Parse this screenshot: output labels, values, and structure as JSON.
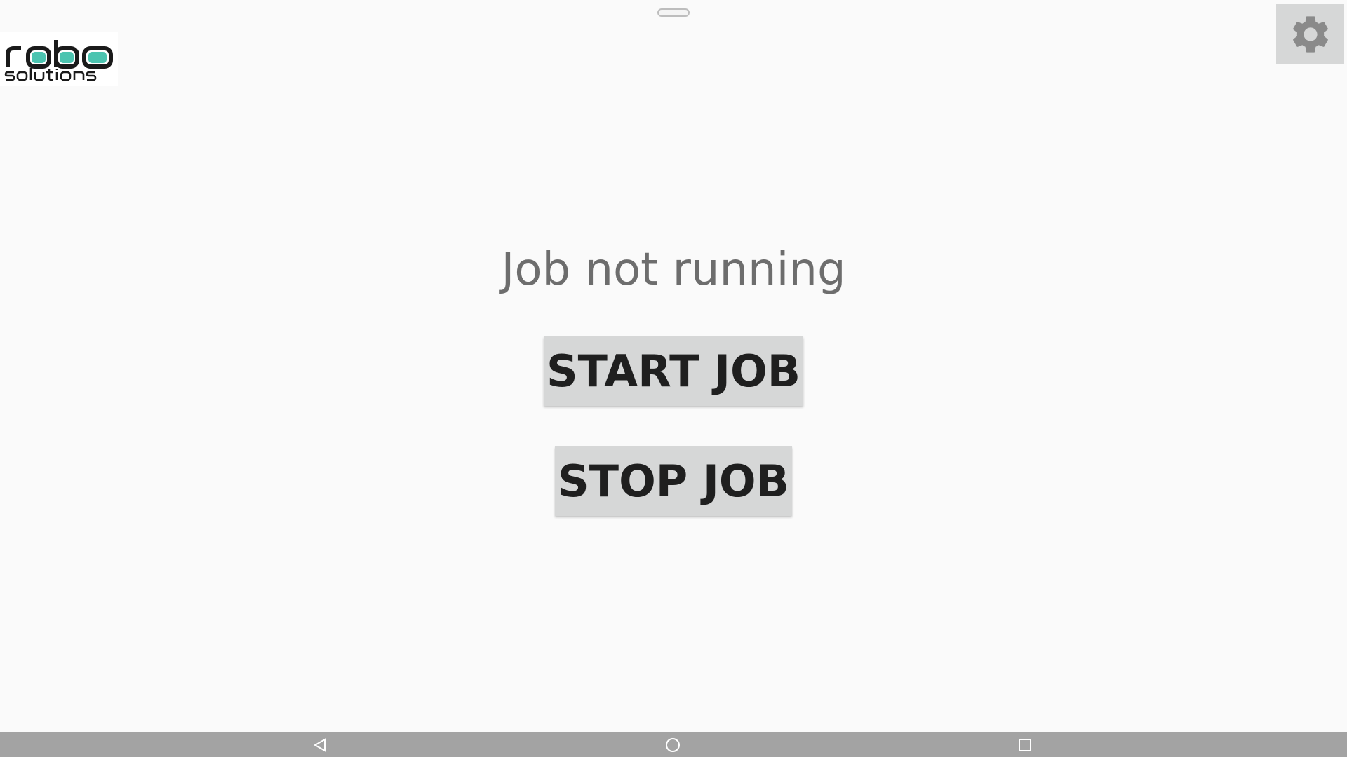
{
  "app": {
    "logo_text_primary": "robo",
    "logo_text_secondary": "solutions",
    "status": "Job not running",
    "start_button_label": "START JOB",
    "stop_button_label": "STOP JOB",
    "settings_icon": "gear-icon"
  },
  "system_nav": {
    "back_icon": "back-triangle-icon",
    "home_icon": "home-circle-icon",
    "recents_icon": "recents-square-icon"
  },
  "colors": {
    "background": "#fafafa",
    "button_bg": "#d6d7d7",
    "button_text": "#1f1f1f",
    "status_text": "#6d6d6d",
    "gear": "#8a8a8a",
    "nav_bar": "#a3a3a3",
    "logo_accent": "#4cc4b0"
  }
}
